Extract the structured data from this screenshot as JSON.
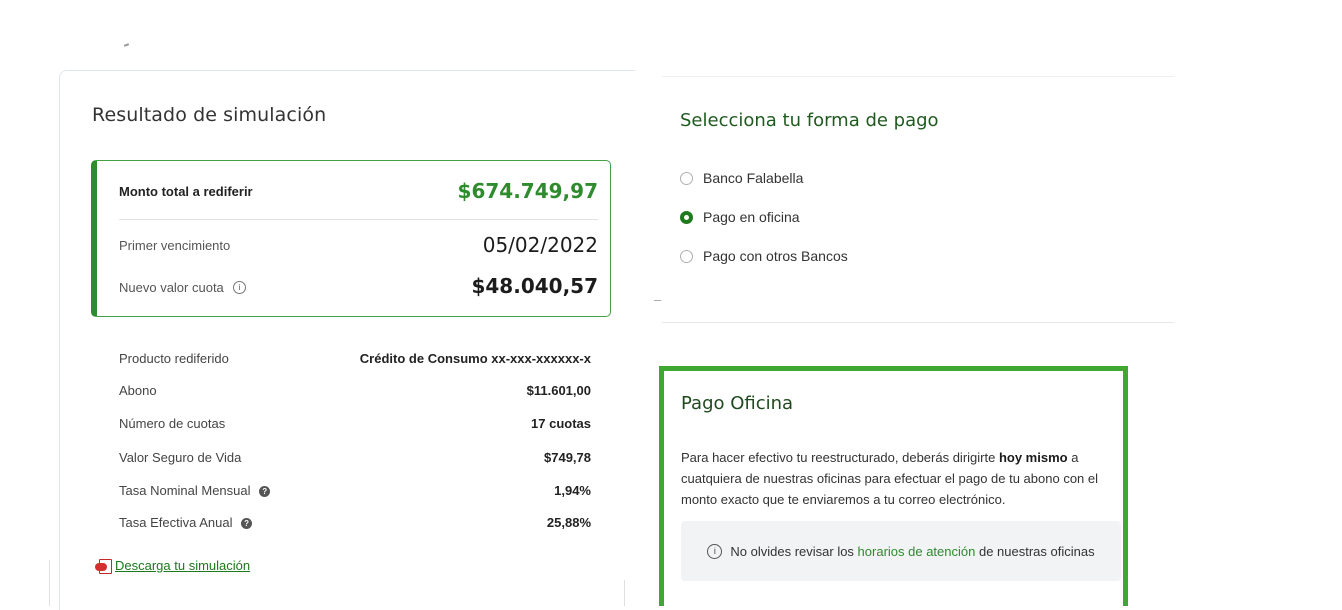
{
  "simulation": {
    "title": "Resultado de simulación",
    "summary": {
      "total_label": "Monto total a rediferir",
      "total_value": "$674.749,97",
      "first_due_label": "Primer vencimiento",
      "first_due_value": "05/02/2022",
      "new_fee_label": "Nuevo valor cuota",
      "new_fee_value": "$48.040,57"
    },
    "details": [
      {
        "label": "Producto rediferido",
        "value": "Crédito de Consumo xx-xxx-xxxxxx-x"
      },
      {
        "label": "Abono",
        "value": "$11.601,00"
      },
      {
        "label": "Número de cuotas",
        "value": "17 cuotas"
      },
      {
        "label": "Valor Seguro de Vida",
        "value": "$749,78"
      },
      {
        "label": "Tasa Nominal Mensual",
        "value": "1,94%"
      },
      {
        "label": "Tasa Efectiva Anual",
        "value": "25,88%"
      }
    ],
    "download_label": "Descarga tu simulación"
  },
  "payment": {
    "title": "Selecciona tu forma de pago",
    "options": [
      {
        "label": "Banco Falabella",
        "selected": false
      },
      {
        "label": "Pago en oficina",
        "selected": true
      },
      {
        "label": "Pago con otros Bancos",
        "selected": false
      }
    ]
  },
  "oficina": {
    "title": "Pago Oficina",
    "text_part1": "Para hacer efectivo tu reestructurado, deberás dirigirte ",
    "text_bold": "hoy mismo",
    "text_part2": " a cuatquiera de nuestras oficinas para efectuar el pago de tu abono con el monto exacto que te enviaremos a tu correo electrónico.",
    "notice_before": "No olvides revisar los ",
    "notice_link": "horarios de atención",
    "notice_after": " de nuestras oficinas"
  },
  "colors": {
    "brand_green": "#2e8b2e",
    "highlight_green": "#3ea832"
  }
}
